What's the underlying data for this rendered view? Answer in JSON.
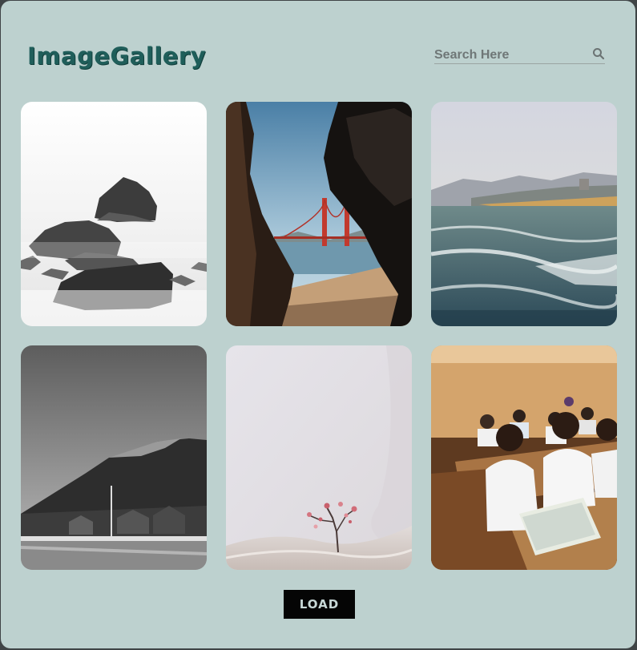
{
  "header": {
    "logo_text": "ImageGallery",
    "search": {
      "placeholder": "Search Here",
      "value": "",
      "icon": "search-icon"
    }
  },
  "gallery": {
    "images": [
      {
        "subject": "misty-rocks",
        "tone": "monochrome"
      },
      {
        "subject": "golden-gate-bridge-through-rocks",
        "tone": "color"
      },
      {
        "subject": "ocean-beach-waves",
        "tone": "color"
      },
      {
        "subject": "mountain-village",
        "tone": "monochrome"
      },
      {
        "subject": "flower-branch-on-fabric",
        "tone": "color"
      },
      {
        "subject": "classroom-students",
        "tone": "color"
      }
    ]
  },
  "actions": {
    "load_label": "LOAD"
  },
  "colors": {
    "background": "#bdd1cf",
    "logo": "#1f5e5a",
    "button_bg": "#050505",
    "button_text": "#c7d7d6"
  }
}
